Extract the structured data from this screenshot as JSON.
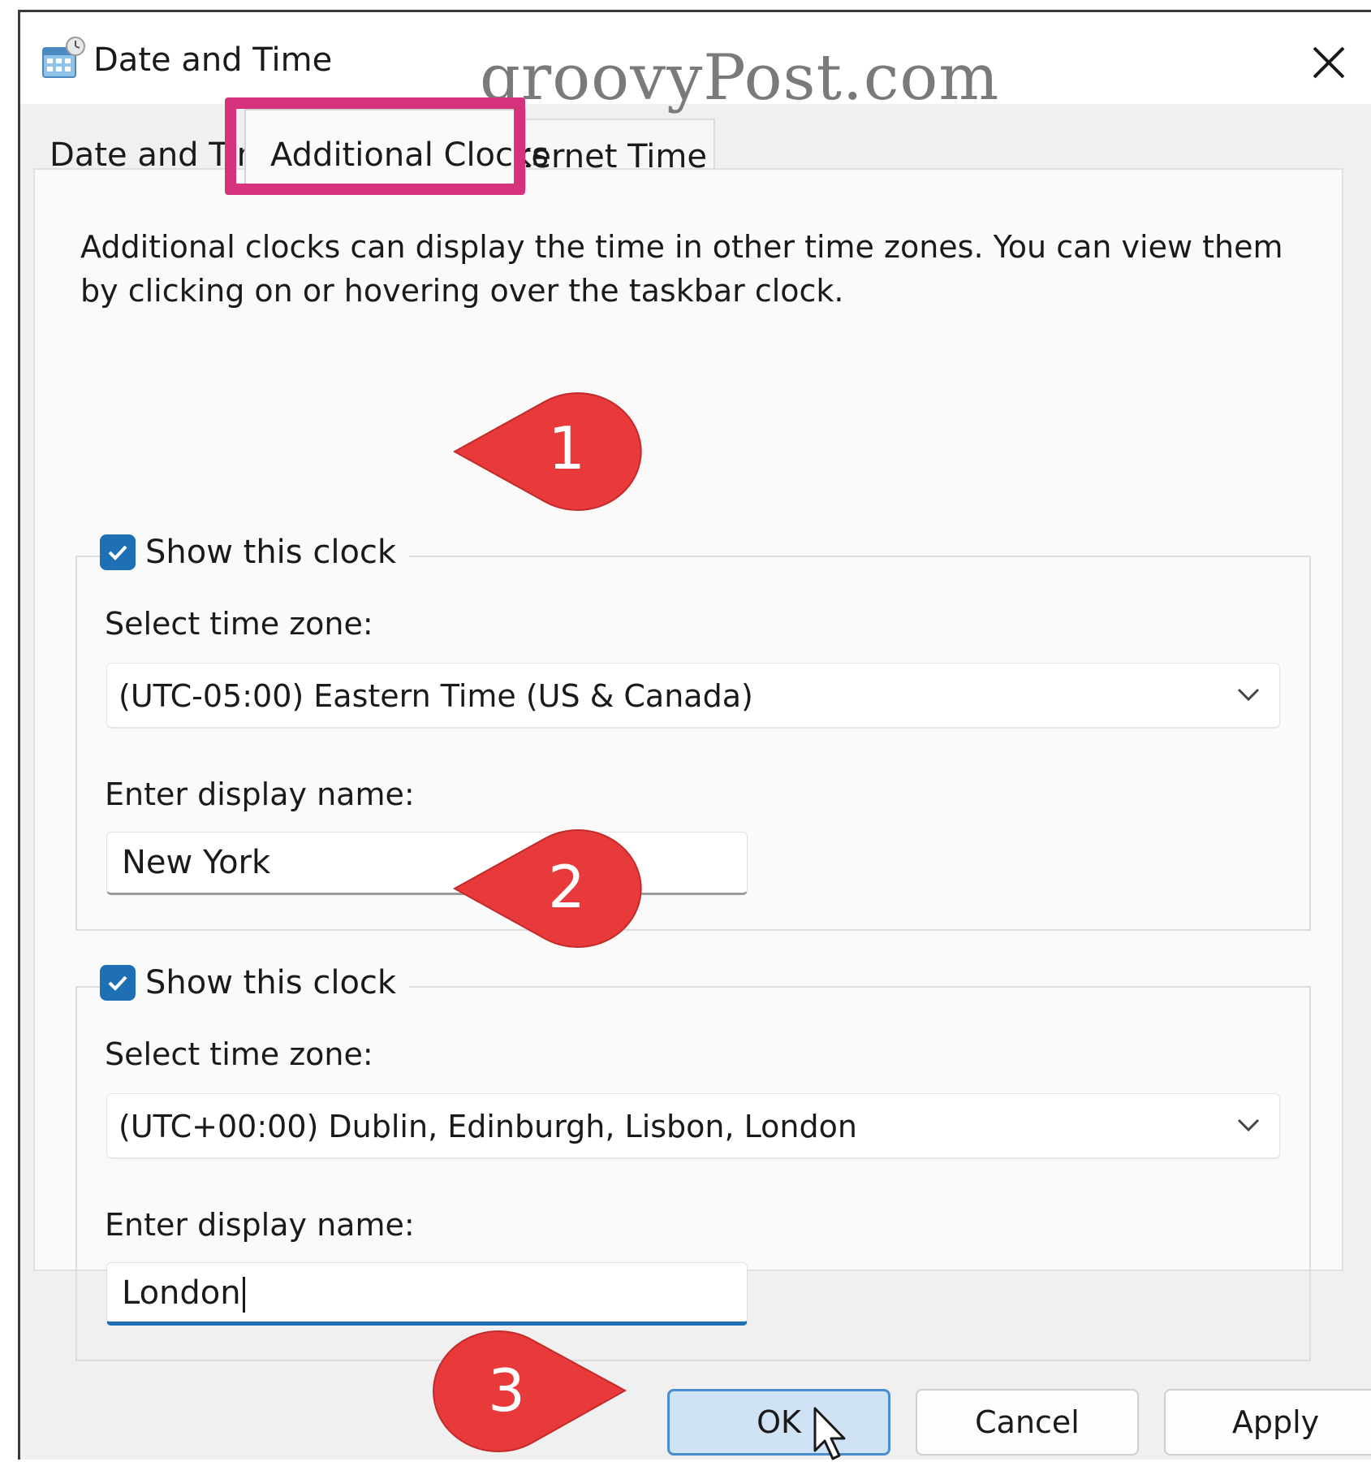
{
  "window": {
    "title": "Date and Time",
    "watermark": "groovyPost.com"
  },
  "tabs": [
    {
      "label": "Date and Time",
      "selected": false
    },
    {
      "label": "Additional Clocks",
      "selected": true
    },
    {
      "label": "Internet Time",
      "selected": false
    }
  ],
  "panel": {
    "description": "Additional clocks can display the time in other time zones. You can view them by clicking on or hovering over the taskbar clock."
  },
  "clocks": [
    {
      "show_label": "Show this clock",
      "checked": true,
      "zone_label": "Select time zone:",
      "zone_value": "(UTC-05:00) Eastern Time (US & Canada)",
      "name_label": "Enter display name:",
      "name_value": "New York"
    },
    {
      "show_label": "Show this clock",
      "checked": true,
      "zone_label": "Select time zone:",
      "zone_value": "(UTC+00:00) Dublin, Edinburgh, Lisbon, London",
      "name_label": "Enter display name:",
      "name_value": "London"
    }
  ],
  "buttons": {
    "ok": "OK",
    "cancel": "Cancel",
    "apply": "Apply"
  },
  "callouts": [
    "1",
    "2",
    "3"
  ],
  "colors": {
    "accent": "#1f6fb5",
    "highlight": "#d4337c",
    "callout": "#e83a3a"
  }
}
